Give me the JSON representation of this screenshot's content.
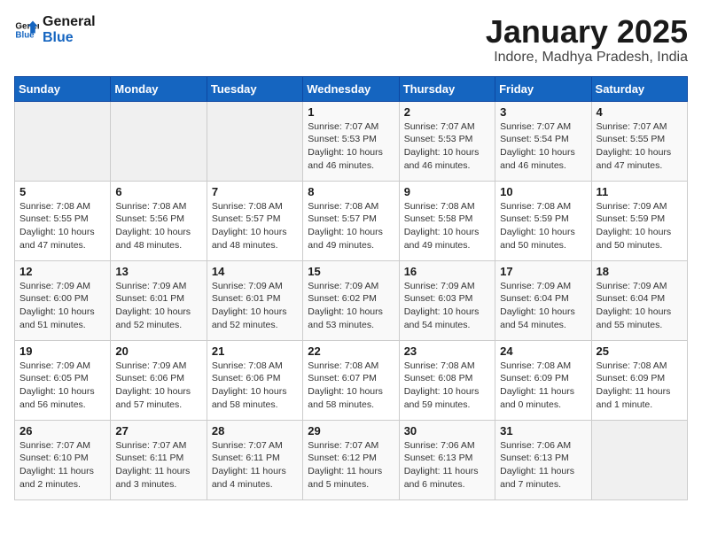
{
  "header": {
    "logo_general": "General",
    "logo_blue": "Blue",
    "title": "January 2025",
    "subtitle": "Indore, Madhya Pradesh, India"
  },
  "weekdays": [
    "Sunday",
    "Monday",
    "Tuesday",
    "Wednesday",
    "Thursday",
    "Friday",
    "Saturday"
  ],
  "weeks": [
    [
      {
        "day": "",
        "sunrise": "",
        "sunset": "",
        "daylight": ""
      },
      {
        "day": "",
        "sunrise": "",
        "sunset": "",
        "daylight": ""
      },
      {
        "day": "",
        "sunrise": "",
        "sunset": "",
        "daylight": ""
      },
      {
        "day": "1",
        "sunrise": "Sunrise: 7:07 AM",
        "sunset": "Sunset: 5:53 PM",
        "daylight": "Daylight: 10 hours and 46 minutes."
      },
      {
        "day": "2",
        "sunrise": "Sunrise: 7:07 AM",
        "sunset": "Sunset: 5:53 PM",
        "daylight": "Daylight: 10 hours and 46 minutes."
      },
      {
        "day": "3",
        "sunrise": "Sunrise: 7:07 AM",
        "sunset": "Sunset: 5:54 PM",
        "daylight": "Daylight: 10 hours and 46 minutes."
      },
      {
        "day": "4",
        "sunrise": "Sunrise: 7:07 AM",
        "sunset": "Sunset: 5:55 PM",
        "daylight": "Daylight: 10 hours and 47 minutes."
      }
    ],
    [
      {
        "day": "5",
        "sunrise": "Sunrise: 7:08 AM",
        "sunset": "Sunset: 5:55 PM",
        "daylight": "Daylight: 10 hours and 47 minutes."
      },
      {
        "day": "6",
        "sunrise": "Sunrise: 7:08 AM",
        "sunset": "Sunset: 5:56 PM",
        "daylight": "Daylight: 10 hours and 48 minutes."
      },
      {
        "day": "7",
        "sunrise": "Sunrise: 7:08 AM",
        "sunset": "Sunset: 5:57 PM",
        "daylight": "Daylight: 10 hours and 48 minutes."
      },
      {
        "day": "8",
        "sunrise": "Sunrise: 7:08 AM",
        "sunset": "Sunset: 5:57 PM",
        "daylight": "Daylight: 10 hours and 49 minutes."
      },
      {
        "day": "9",
        "sunrise": "Sunrise: 7:08 AM",
        "sunset": "Sunset: 5:58 PM",
        "daylight": "Daylight: 10 hours and 49 minutes."
      },
      {
        "day": "10",
        "sunrise": "Sunrise: 7:08 AM",
        "sunset": "Sunset: 5:59 PM",
        "daylight": "Daylight: 10 hours and 50 minutes."
      },
      {
        "day": "11",
        "sunrise": "Sunrise: 7:09 AM",
        "sunset": "Sunset: 5:59 PM",
        "daylight": "Daylight: 10 hours and 50 minutes."
      }
    ],
    [
      {
        "day": "12",
        "sunrise": "Sunrise: 7:09 AM",
        "sunset": "Sunset: 6:00 PM",
        "daylight": "Daylight: 10 hours and 51 minutes."
      },
      {
        "day": "13",
        "sunrise": "Sunrise: 7:09 AM",
        "sunset": "Sunset: 6:01 PM",
        "daylight": "Daylight: 10 hours and 52 minutes."
      },
      {
        "day": "14",
        "sunrise": "Sunrise: 7:09 AM",
        "sunset": "Sunset: 6:01 PM",
        "daylight": "Daylight: 10 hours and 52 minutes."
      },
      {
        "day": "15",
        "sunrise": "Sunrise: 7:09 AM",
        "sunset": "Sunset: 6:02 PM",
        "daylight": "Daylight: 10 hours and 53 minutes."
      },
      {
        "day": "16",
        "sunrise": "Sunrise: 7:09 AM",
        "sunset": "Sunset: 6:03 PM",
        "daylight": "Daylight: 10 hours and 54 minutes."
      },
      {
        "day": "17",
        "sunrise": "Sunrise: 7:09 AM",
        "sunset": "Sunset: 6:04 PM",
        "daylight": "Daylight: 10 hours and 54 minutes."
      },
      {
        "day": "18",
        "sunrise": "Sunrise: 7:09 AM",
        "sunset": "Sunset: 6:04 PM",
        "daylight": "Daylight: 10 hours and 55 minutes."
      }
    ],
    [
      {
        "day": "19",
        "sunrise": "Sunrise: 7:09 AM",
        "sunset": "Sunset: 6:05 PM",
        "daylight": "Daylight: 10 hours and 56 minutes."
      },
      {
        "day": "20",
        "sunrise": "Sunrise: 7:09 AM",
        "sunset": "Sunset: 6:06 PM",
        "daylight": "Daylight: 10 hours and 57 minutes."
      },
      {
        "day": "21",
        "sunrise": "Sunrise: 7:08 AM",
        "sunset": "Sunset: 6:06 PM",
        "daylight": "Daylight: 10 hours and 58 minutes."
      },
      {
        "day": "22",
        "sunrise": "Sunrise: 7:08 AM",
        "sunset": "Sunset: 6:07 PM",
        "daylight": "Daylight: 10 hours and 58 minutes."
      },
      {
        "day": "23",
        "sunrise": "Sunrise: 7:08 AM",
        "sunset": "Sunset: 6:08 PM",
        "daylight": "Daylight: 10 hours and 59 minutes."
      },
      {
        "day": "24",
        "sunrise": "Sunrise: 7:08 AM",
        "sunset": "Sunset: 6:09 PM",
        "daylight": "Daylight: 11 hours and 0 minutes."
      },
      {
        "day": "25",
        "sunrise": "Sunrise: 7:08 AM",
        "sunset": "Sunset: 6:09 PM",
        "daylight": "Daylight: 11 hours and 1 minute."
      }
    ],
    [
      {
        "day": "26",
        "sunrise": "Sunrise: 7:07 AM",
        "sunset": "Sunset: 6:10 PM",
        "daylight": "Daylight: 11 hours and 2 minutes."
      },
      {
        "day": "27",
        "sunrise": "Sunrise: 7:07 AM",
        "sunset": "Sunset: 6:11 PM",
        "daylight": "Daylight: 11 hours and 3 minutes."
      },
      {
        "day": "28",
        "sunrise": "Sunrise: 7:07 AM",
        "sunset": "Sunset: 6:11 PM",
        "daylight": "Daylight: 11 hours and 4 minutes."
      },
      {
        "day": "29",
        "sunrise": "Sunrise: 7:07 AM",
        "sunset": "Sunset: 6:12 PM",
        "daylight": "Daylight: 11 hours and 5 minutes."
      },
      {
        "day": "30",
        "sunrise": "Sunrise: 7:06 AM",
        "sunset": "Sunset: 6:13 PM",
        "daylight": "Daylight: 11 hours and 6 minutes."
      },
      {
        "day": "31",
        "sunrise": "Sunrise: 7:06 AM",
        "sunset": "Sunset: 6:13 PM",
        "daylight": "Daylight: 11 hours and 7 minutes."
      },
      {
        "day": "",
        "sunrise": "",
        "sunset": "",
        "daylight": ""
      }
    ]
  ]
}
